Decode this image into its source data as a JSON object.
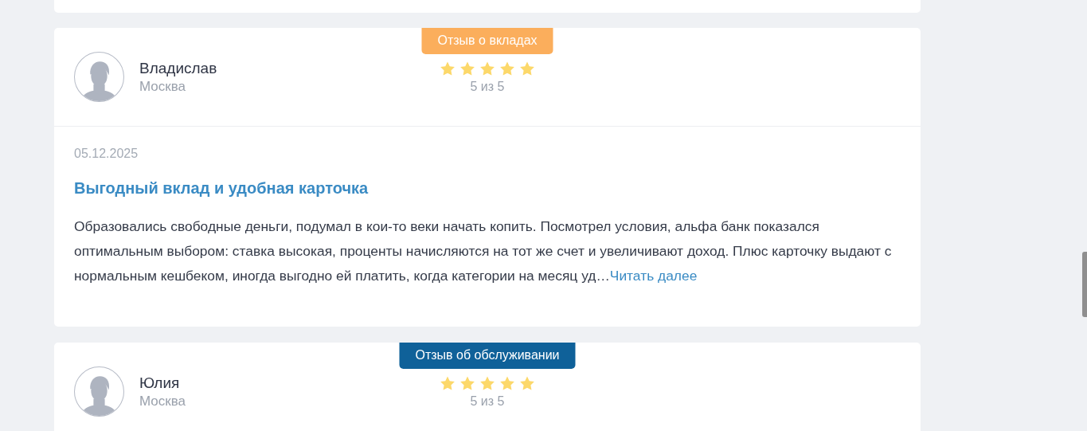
{
  "reviews": [
    {
      "badge": {
        "label": "Отзыв о вкладах",
        "color": "#fbae5c"
      },
      "author": "Владислав",
      "city": "Москва",
      "stars": 5,
      "rating": "5 из 5",
      "date": "05.12.2025",
      "title": "Выгодный вклад и удобная карточка",
      "text": "Образовались свободные деньги, подумал в кои-то веки начать копить. Посмотрел условия, альфа банк показался оптимальным выбором: ставка высокая, проценты начисляются на тот же счет и увеличивают доход. Плюс карточку выдают с нормальным кешбеком, иногда выгодно ей платить, когда категории на месяц уд…",
      "read_more": "Читать далее"
    },
    {
      "badge": {
        "label": "Отзыв об обслуживании",
        "color": "#0f6199"
      },
      "author": "Юлия",
      "city": "Москва",
      "stars": 5,
      "rating": "5 из 5"
    }
  ]
}
